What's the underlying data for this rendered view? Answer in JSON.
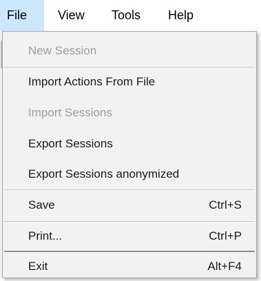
{
  "menubar": {
    "items": [
      {
        "label": "File"
      },
      {
        "label": "View"
      },
      {
        "label": "Tools"
      },
      {
        "label": "Help"
      }
    ]
  },
  "file_menu": {
    "items": [
      {
        "label": "New Session",
        "enabled": false,
        "shortcut": ""
      },
      {
        "label": "Import Actions From File",
        "enabled": true,
        "shortcut": ""
      },
      {
        "label": "Import Sessions",
        "enabled": false,
        "shortcut": ""
      },
      {
        "label": "Export Sessions",
        "enabled": true,
        "shortcut": ""
      },
      {
        "label": "Export Sessions anonymized",
        "enabled": true,
        "shortcut": ""
      },
      {
        "label": "Save",
        "enabled": true,
        "shortcut": "Ctrl+S"
      },
      {
        "label": "Print...",
        "enabled": true,
        "shortcut": "Ctrl+P"
      },
      {
        "label": "Exit",
        "enabled": true,
        "shortcut": "Alt+F4"
      }
    ]
  },
  "colors": {
    "active_menubar_bg": "#cce8ff",
    "menu_bg": "#f2f2f2",
    "disabled_text": "#9d9d9d"
  }
}
